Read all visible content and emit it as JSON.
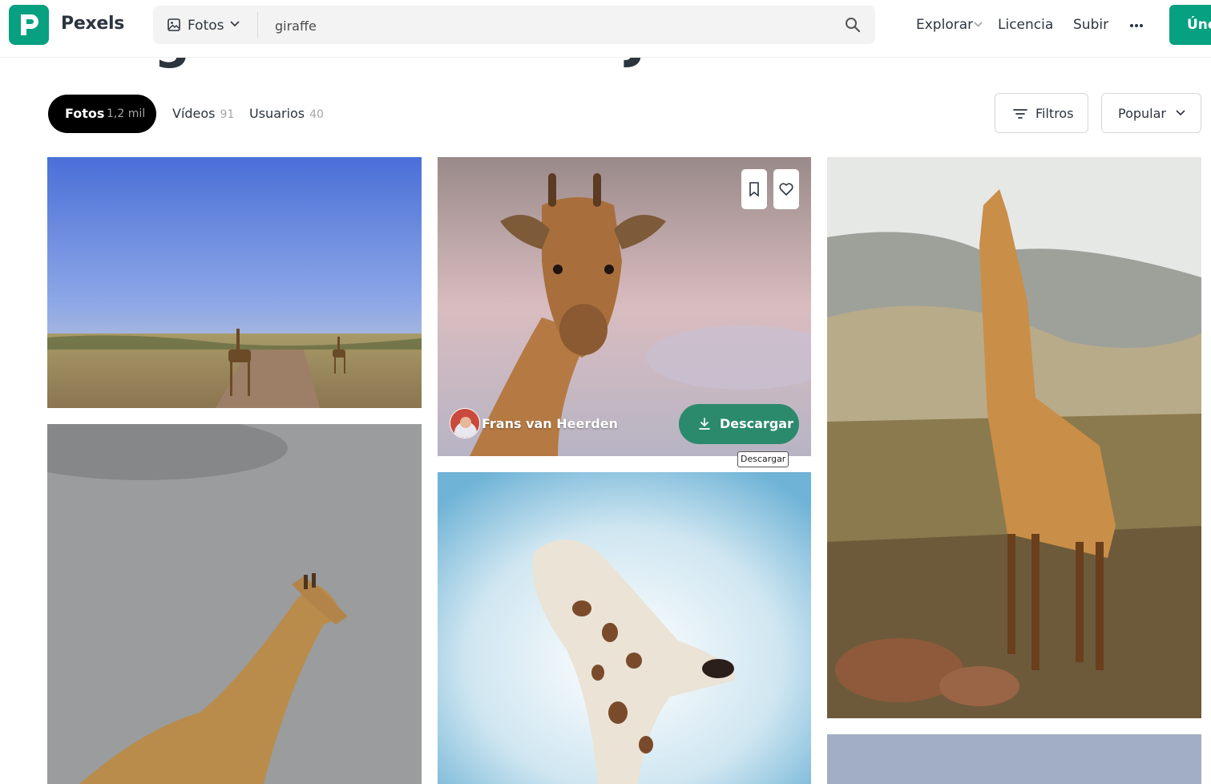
{
  "header": {
    "brand": "Pexels",
    "search_type": "Fotos",
    "search_value": "giraffe",
    "nav": {
      "explore": "Explorar",
      "license": "Licencia",
      "upload": "Subir"
    },
    "join_label": "Únete"
  },
  "page_title": "Imágenes Gratis de Jirafa",
  "tabs": [
    {
      "label": "Fotos",
      "count": "1,2 mil"
    },
    {
      "label": "Vídeos",
      "count": "91"
    },
    {
      "label": "Usuarios",
      "count": "40"
    }
  ],
  "filters_label": "Filtros",
  "sort_label": "Popular",
  "hovered_photo": {
    "author": "Frans van Heerden",
    "download_label": "Descargar",
    "tooltip": "Descargar"
  },
  "colors": {
    "brand": "#07a081",
    "download": "#2b8a6c",
    "text": "#2c343e"
  }
}
